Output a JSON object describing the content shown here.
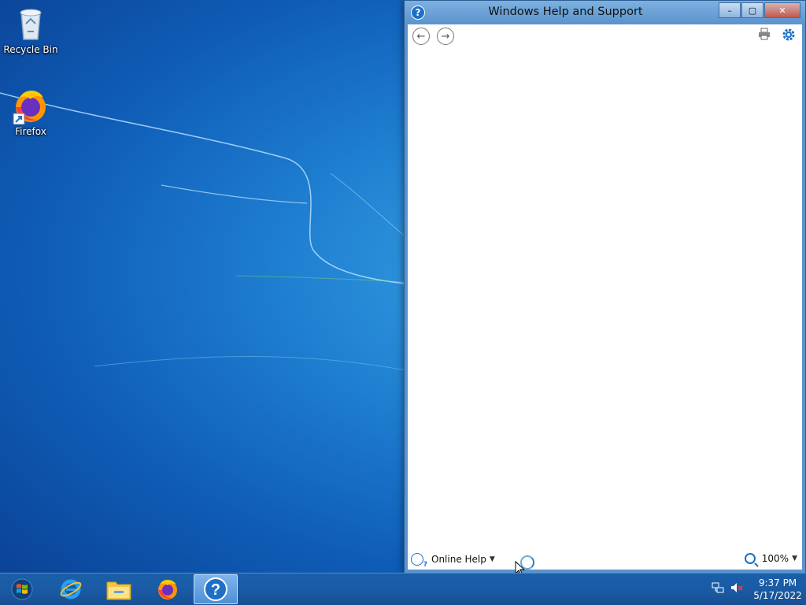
{
  "desktop": {
    "icons": [
      {
        "label": "Recycle Bin",
        "icon": "recycle-bin-icon"
      },
      {
        "label": "Firefox",
        "icon": "firefox-icon"
      }
    ]
  },
  "window": {
    "title": "Windows Help and Support",
    "caption_buttons": {
      "minimize": "–",
      "maximize": "▢",
      "close": "✕"
    },
    "toolbar": {
      "back": "back-arrow-icon",
      "forward": "forward-arrow-icon",
      "print": "print-icon",
      "options": "gear-icon"
    },
    "status": {
      "online_help_label": "Online Help",
      "zoom_label": "100%"
    }
  },
  "taskbar": {
    "apps": [
      {
        "name": "Internet Explorer",
        "icon": "internet-explorer-icon"
      },
      {
        "name": "File Explorer",
        "icon": "folder-icon"
      },
      {
        "name": "Firefox",
        "icon": "firefox-icon"
      },
      {
        "name": "Windows Help and Support",
        "icon": "help-icon",
        "active": true
      }
    ],
    "clock": {
      "time": "9:37 PM",
      "date": "5/17/2022"
    }
  },
  "colors": {
    "accent": "#1d6fc8",
    "taskbar": "#1a5ba6"
  }
}
